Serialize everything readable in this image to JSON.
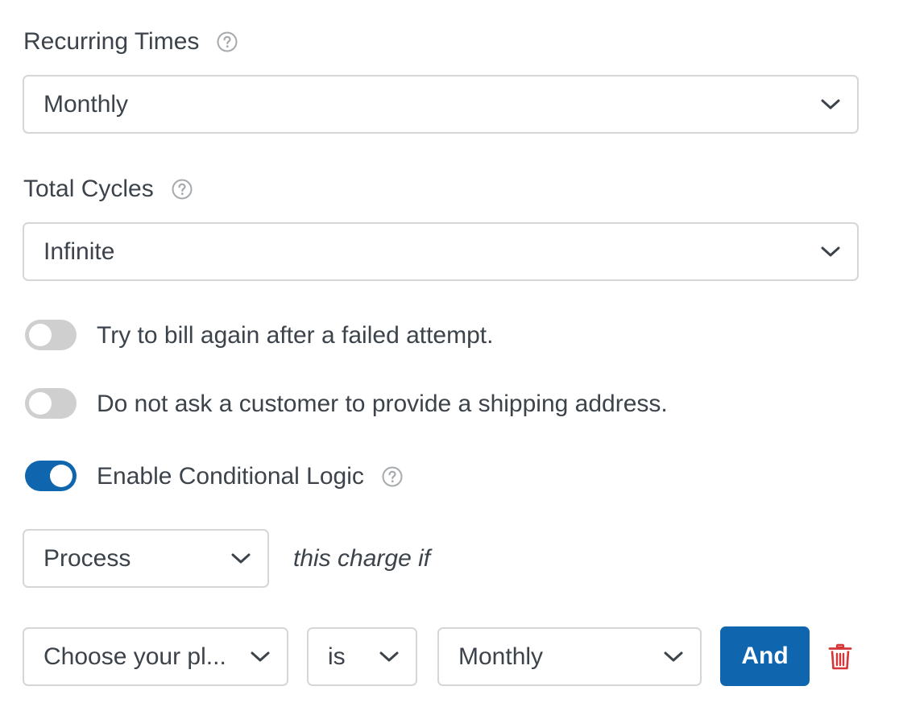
{
  "recurring": {
    "label": "Recurring Times",
    "value": "Monthly"
  },
  "cycles": {
    "label": "Total Cycles",
    "value": "Infinite"
  },
  "toggles": [
    {
      "label": "Try to bill again after a failed attempt.",
      "on": false
    },
    {
      "label": "Do not ask a customer to provide a shipping address.",
      "on": false
    },
    {
      "label": "Enable Conditional Logic",
      "on": true
    }
  ],
  "conditional": {
    "action_value": "Process",
    "action_suffix": "this charge if",
    "field_value": "Choose your pl...",
    "operator_value": "is",
    "compare_value": "Monthly",
    "and_label": "And"
  },
  "colors": {
    "accent": "#0f66af",
    "toggle_off": "#cfcfcf",
    "delete": "#d63638",
    "help_icon": "#a7aaad"
  }
}
